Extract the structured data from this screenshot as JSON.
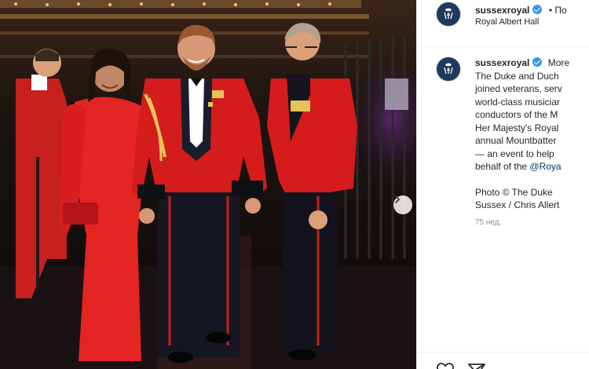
{
  "post": {
    "username": "sussexroyal",
    "follow_label": "• По",
    "location": "Royal Albert Hall",
    "caption": {
      "username": "sussexroyal",
      "more": "More",
      "lines": [
        "The Duke and Duch",
        "joined veterans, serv",
        "world-class musiciar",
        "conductors of the M",
        "Her Majesty's Royal",
        "annual Mountbatter",
        "— an event to help",
        "behalf of the "
      ],
      "mention": "@Roya",
      "credit_lines": [
        "Photo © The Duke",
        "Sussex / Chris Allert"
      ]
    },
    "time_ago": "75 нед."
  },
  "icons": {
    "avatar": "monogram-crest-icon",
    "verified": "verified-badge-icon",
    "next": "chevron-right-icon",
    "like": "heart-icon",
    "share": "paper-plane-icon"
  },
  "colors": {
    "verified": "#3897f0",
    "avatar_bg": "#1f3b5c",
    "mention": "#00376b",
    "muted": "#8e8e8e"
  }
}
